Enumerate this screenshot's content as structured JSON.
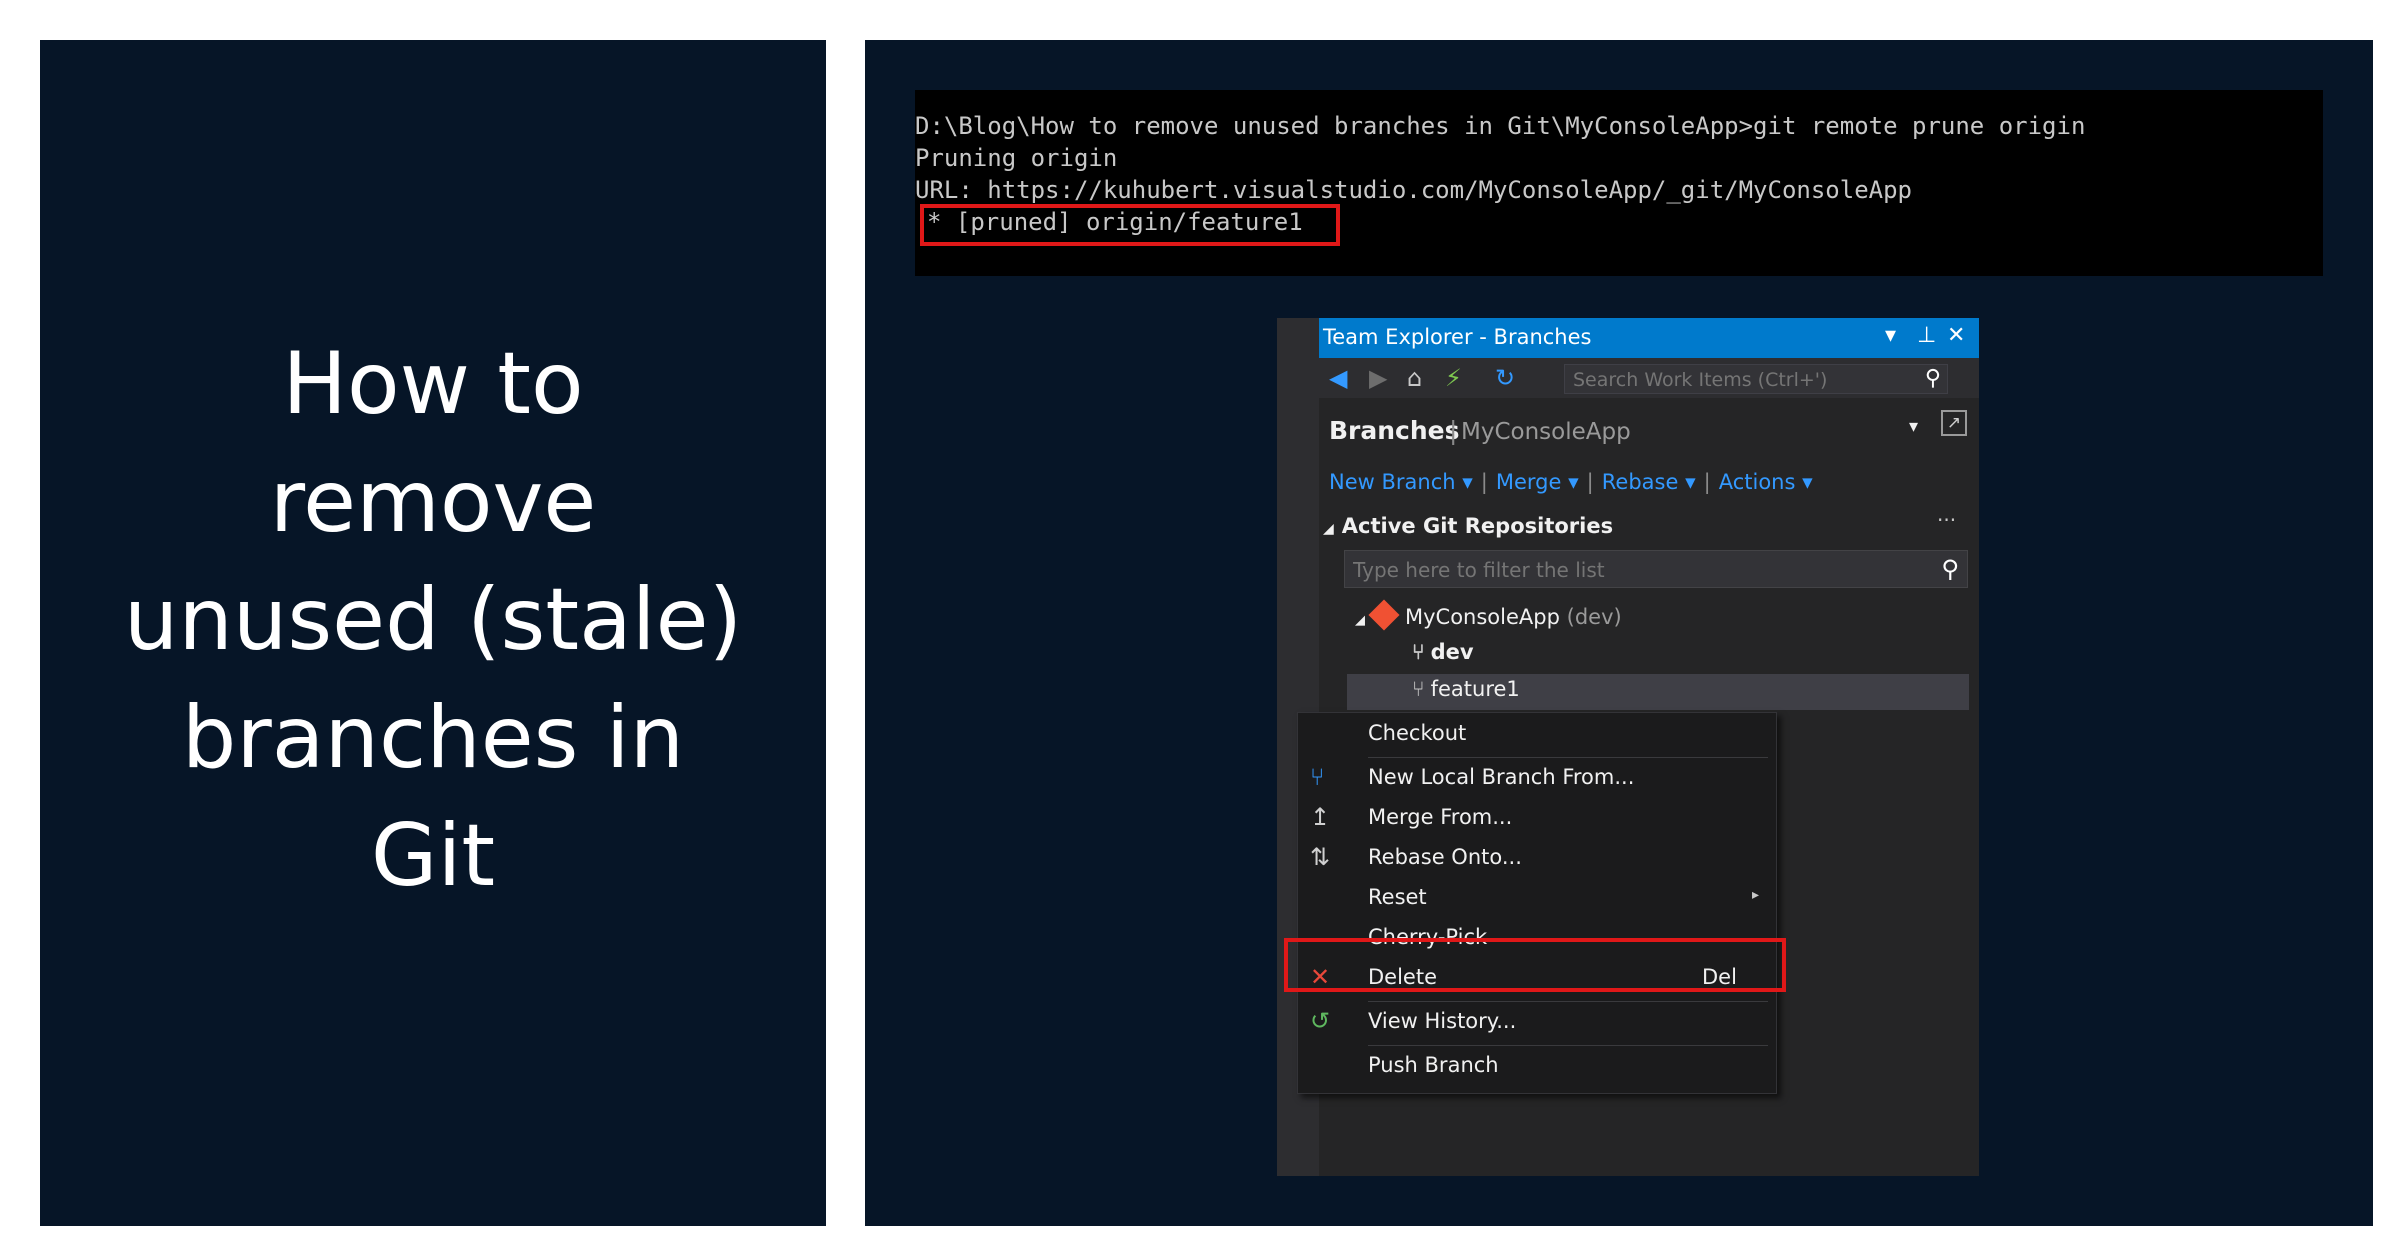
{
  "title_lines": [
    "How to",
    "remove",
    "unused (stale)",
    "branches in",
    "Git"
  ],
  "terminal": {
    "lines": [
      "D:\\Blog\\How to remove unused branches in Git\\MyConsoleApp>git remote prune origin",
      "Pruning origin",
      "URL: https://kuhubert.visualstudio.com/MyConsoleApp/_git/MyConsoleApp",
      "* [pruned] origin/feature1"
    ]
  },
  "team_explorer": {
    "title": "Team Explorer - Branches",
    "title_controls": [
      "▾",
      "⊥",
      "✕"
    ],
    "search_placeholder": "Search Work Items (Ctrl+')",
    "heading": "Branches",
    "separator": "|",
    "repo_name": "MyConsoleApp",
    "actions": [
      "New Branch",
      "Merge",
      "Rebase",
      "Actions"
    ],
    "section_title": "Active Git Repositories",
    "more": "···",
    "filter_placeholder": "Type here to filter the list",
    "repo": {
      "name": "MyConsoleApp",
      "branch_tag": "(dev)"
    },
    "branches": [
      "dev",
      "feature1"
    ]
  },
  "context_menu": {
    "items": [
      {
        "label": "Checkout",
        "icon": "",
        "shortcut": ""
      },
      {
        "label": "New Local Branch From...",
        "icon": "branch-icon",
        "shortcut": ""
      },
      {
        "label": "Merge From...",
        "icon": "merge-icon",
        "shortcut": ""
      },
      {
        "label": "Rebase Onto...",
        "icon": "rebase-icon",
        "shortcut": ""
      },
      {
        "label": "Reset",
        "icon": "",
        "shortcut": "",
        "submenu": true
      },
      {
        "label": "Cherry-Pick",
        "icon": "",
        "shortcut": ""
      },
      {
        "label": "Delete",
        "icon": "delete-icon",
        "shortcut": "Del"
      },
      {
        "label": "View History...",
        "icon": "history-icon",
        "shortcut": ""
      },
      {
        "label": "Push Branch",
        "icon": "",
        "shortcut": ""
      }
    ]
  },
  "colors": {
    "panel_background": "#061527",
    "titlebar_blue": "#007acc",
    "link_blue": "#3399ff",
    "highlight_red": "#e01818"
  }
}
